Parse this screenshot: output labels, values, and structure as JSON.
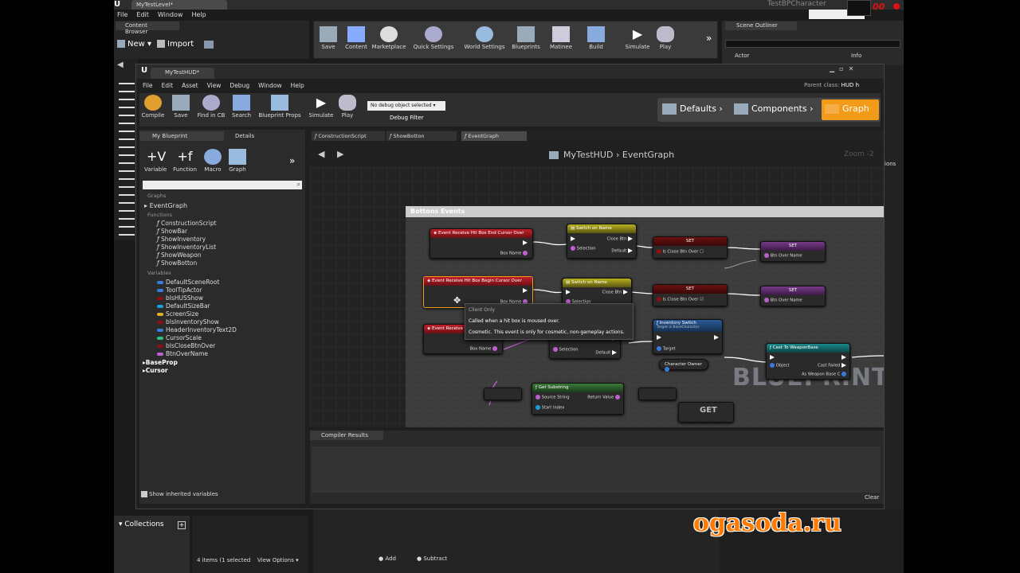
{
  "top": {
    "level_tab": "MyTestLevel*",
    "project": "TestBPCharacter",
    "timer": "00"
  },
  "main_menu": [
    "File",
    "Edit",
    "Window",
    "Help"
  ],
  "content_browser": {
    "tab": "Content Browser",
    "new_label": "New",
    "import_label": "Import",
    "items_count": "4 items (1 selected",
    "view_options": "View Options",
    "collections": "Collections"
  },
  "level_toolbar": [
    "Save",
    "Content",
    "Marketplace",
    "Quick Settings",
    "World Settings",
    "Blueprints",
    "Matinee",
    "Build",
    "Simulate",
    "Play"
  ],
  "scene_outliner": {
    "tab": "Scene Outliner",
    "col_actor": "Actor",
    "col_info": "Info",
    "options": "ions"
  },
  "bp": {
    "tab": "MyTestHUD*",
    "parent_class_label": "Parent class:",
    "parent_class": "HUD h",
    "menu": [
      "File",
      "Edit",
      "Asset",
      "View",
      "Debug",
      "Window",
      "Help"
    ],
    "toolbar": [
      "Compile",
      "Save",
      "Find in CB",
      "Search",
      "Blueprint Props",
      "Simulate",
      "Play"
    ],
    "debug_object": "No debug object selected",
    "debug_filter": "Debug Filter",
    "modes": [
      "Defaults",
      "Components",
      "Graph"
    ],
    "my_blueprint_tab": "My Blueprint",
    "details_tab": "Details",
    "add_buttons": [
      "Variable",
      "Function",
      "Macro",
      "Graph"
    ],
    "graphs_header": "Graphs",
    "event_graph": "EventGraph",
    "functions_header": "Functions",
    "functions": [
      "ConstructionScript",
      "ShowBar",
      "ShowInventory",
      "ShowInventoryList",
      "ShowWeapon",
      "ShowBotton"
    ],
    "variables_header": "Variables",
    "variables": [
      {
        "name": "DefaultSceneRoot",
        "color": "#3a7be0"
      },
      {
        "name": "ToolTipActor",
        "color": "#3a7be0"
      },
      {
        "name": "bIsHUSShow",
        "color": "#8c1010"
      },
      {
        "name": "DefaultSizeBar",
        "color": "#1aa0d8"
      },
      {
        "name": "ScreenSize",
        "color": "#e0b020"
      },
      {
        "name": "bIsInventoryShow",
        "color": "#8c1010"
      },
      {
        "name": "HeaderInventoryText2D",
        "color": "#3a7be0"
      },
      {
        "name": "CursorScale",
        "color": "#2ec080"
      },
      {
        "name": "bIsCloseBtnOver",
        "color": "#8c1010"
      },
      {
        "name": "BtnOverName",
        "color": "#c060d0"
      }
    ],
    "categories": [
      "BaseProp",
      "Cursor"
    ],
    "show_inherited": "Show inherited variables",
    "graph_tabs": [
      "ConstructionScript",
      "ShowBotton",
      "EventGraph"
    ],
    "breadcrumb": [
      "MyTestHUD",
      "EventGraph"
    ],
    "zoom": "Zoom -2",
    "comment": "Bottons Events",
    "watermark": "BLUEPRINT",
    "compiler_tab": "Compiler Results",
    "clear": "Clear"
  },
  "nodes": {
    "ev_end": {
      "title": "Event Receive Hit Box End Cursor Over",
      "pin": "Box Name"
    },
    "ev_begin": {
      "title": "Event Receive Hit Box Begin Cursor Over",
      "pin": "Box Name"
    },
    "ev_click": {
      "title": "Event Receive",
      "pin": "Box Name"
    },
    "sw1": {
      "title": "Switch on Name",
      "pins": [
        "Selection",
        "Close Btn",
        "Default"
      ]
    },
    "sw2": {
      "title": "Switch on Name",
      "pins": [
        "Selection",
        "Close Btn"
      ]
    },
    "sw3": {
      "pins": [
        "Selection",
        "Close Btn",
        "Default"
      ]
    },
    "set1": {
      "title": "SET",
      "pin": "Is Close Btn Over"
    },
    "set2": {
      "title": "SET",
      "pin": "Btn Over Name"
    },
    "set3": {
      "title": "SET",
      "pin": "Is Close Btn Over"
    },
    "set4": {
      "title": "SET",
      "pin": "Btn Over Name"
    },
    "inv": {
      "title": "Inventory Switch",
      "sub": "Target is BaseCharacter",
      "pin": "Target"
    },
    "char_owner": "Character Owner",
    "cast": {
      "title": "Cast To WeaponBase",
      "pins": [
        "Object",
        "Cast Failed",
        "As Weapon Base C"
      ]
    },
    "substr": {
      "title": "Get Substring",
      "pins": [
        "Source String",
        "Return Value",
        "Start Index"
      ]
    },
    "get": "GET"
  },
  "tooltip": {
    "header": "Client Only",
    "line1": "Called when a hit box is moused over.",
    "line2": "Cosmetic. This event is only for cosmetic, non-gameplay actions."
  },
  "bottom_bar": {
    "add": "Add",
    "subtract": "Subtract"
  },
  "site_watermark": "ogasoda.ru"
}
